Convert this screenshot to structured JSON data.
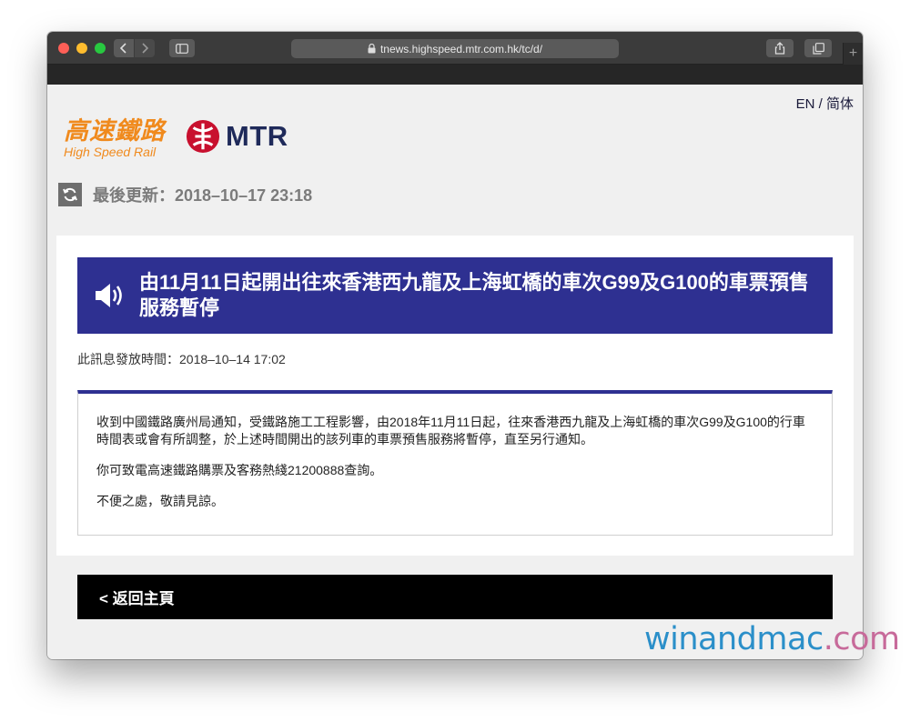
{
  "browser": {
    "url": "tnews.highspeed.mtr.com.hk/tc/d/",
    "new_tab_label": "+"
  },
  "header": {
    "lang_en": "EN",
    "lang_sep": "/",
    "lang_sc": "简体",
    "hsr_logo_cn": "高速鐵路",
    "hsr_logo_en": "High Speed Rail",
    "mtr_logo_text": "MTR"
  },
  "updated": {
    "text": "最後更新：2018–10–17 23:18"
  },
  "notice": {
    "title": "由11月11日起開出往來香港西九龍及上海虹橋的車次G99及G100的車票預售服務暫停",
    "issued": "此訊息發放時間：2018–10–14 17:02",
    "paragraphs": [
      "收到中國鐵路廣州局通知，受鐵路施工工程影響，由2018年11月11日起，往來香港西九龍及上海虹橋的車次G99及G100的行車時間表或會有所調整，於上述時間開出的該列車的車票預售服務將暫停，直至另行通知。",
      "你可致電高速鐵路購票及客務熱綫21200888查詢。",
      "不便之處，敬請見諒。"
    ]
  },
  "footer": {
    "back_home": "< 返回主頁"
  },
  "watermark": {
    "part1": "win",
    "part2": "and",
    "part3": "mac",
    "part4": ".com"
  },
  "colors": {
    "banner": "#2e3091",
    "hsr_orange": "#f08a1d",
    "mtr_red": "#c8102e",
    "mtr_navy": "#1f2a5a"
  },
  "icons": [
    "lock-icon",
    "refresh-icon",
    "speaker-icon",
    "mtr-logo-icon",
    "share-icon",
    "tabs-icon",
    "sidebar-icon",
    "chevron-left-icon",
    "chevron-right-icon"
  ]
}
